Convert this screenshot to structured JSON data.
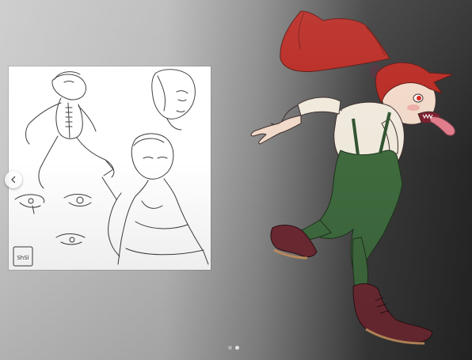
{
  "viewer": {
    "slide_count": 2,
    "active_slide": 2
  },
  "sketch": {
    "signature_text": "ShSl"
  },
  "colors": {
    "hair": "#b8261f",
    "overalls": "#3f6a3e",
    "boots": "#6e2a33",
    "shirt": "#efe9dc",
    "skin": "#f1d9c8",
    "dot_active": "#ffffff",
    "dot_inactive": "rgba(255,255,255,0.45)"
  },
  "icons": {
    "prev": "chevron-left-icon"
  }
}
